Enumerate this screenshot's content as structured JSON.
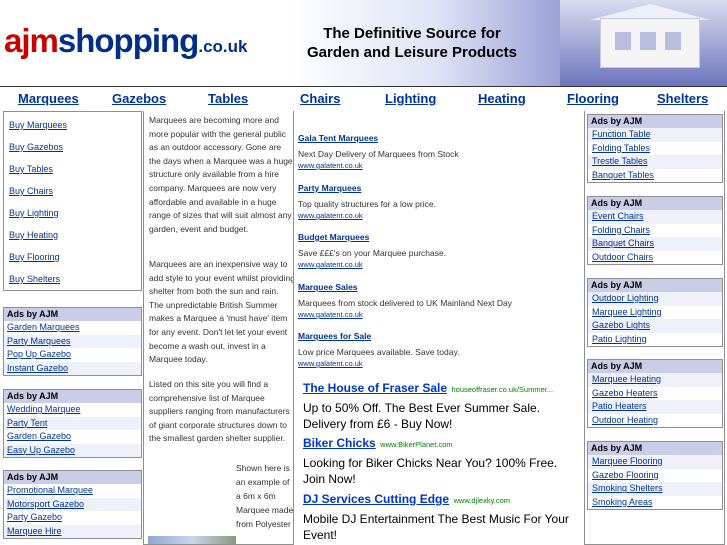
{
  "header": {
    "logo_ajm": "ajm",
    "logo_shopping": "shopping",
    "logo_couk": ".co.uk",
    "tagline_line1": "The Definitive Source for",
    "tagline_line2": "Garden and Leisure Products"
  },
  "nav": [
    "Marquees",
    "Gazebos",
    "Tables",
    "Chairs",
    "Lighting",
    "Heating",
    "Flooring",
    "Shelters"
  ],
  "left_links": [
    "Buy Marquees",
    "Buy Gazebos",
    "Buy Tables",
    "Buy Chairs",
    "Buy Lighting",
    "Buy Heating",
    "Buy Flooring",
    "Buy Shelters"
  ],
  "left_ads": [
    {
      "title": "Ads by AJM",
      "links": [
        "Garden Marquees",
        "Party Marquees",
        "Pop Up Gazebo",
        "Instant Gazebo"
      ]
    },
    {
      "title": "Ads by AJM",
      "links": [
        "Wedding Marquee",
        "Party Tent",
        "Garden Gazebo",
        "Easy Up Gazebo"
      ]
    },
    {
      "title": "Ads by AJM",
      "links": [
        "Promotional Marquee",
        "Motorsport Gazebo",
        "Party Gazebo",
        "Marquee Hire"
      ]
    }
  ],
  "intro": {
    "p1": "Marquees are becoming more and more popular with the general public as an outdoor accessory. Gone are the days when a Marquee was a huge structure only available from a hire company. Marquees are now very affordable and available in a huge range of sizes that will suit almost any garden, event and budget.",
    "p2": "Marquees are an inexpensive way to add style to your event whilst providing shelter from both the sun and rain. The unpredictable British Summer makes a Marquee a 'must have' item for any event. Don't let let your event become a wash out, invest in a Marquee today.",
    "p3": "Listed on this site you will find a comprehensive list of Marquee suppliers ranging from manufacturers of giant corporate structures down to the smallest garden shelter supplier.",
    "caption": "Shown here is an example of a 6m x 6m Marquee made from Polyester"
  },
  "small_ads": [
    {
      "title": "Gala Tent Marquees",
      "desc": "Next Day Delivery of Marquees from Stock",
      "url": "www.galatent.co.uk"
    },
    {
      "title": "Party Marquees",
      "desc": "Top quality structures for a low price.",
      "url": "www.galatent.co.uk"
    },
    {
      "title": "Budget Marquees",
      "desc": "Save £££'s on your Marquee purchase.",
      "url": "www.galatent.co.uk"
    },
    {
      "title": "Marquee Sales",
      "desc": "Marquees from stock delivered to UK Mainland Next Day",
      "url": "www.galatent.co.uk"
    },
    {
      "title": "Marquees for Sale",
      "desc": "Low price Marquees available. Save today.",
      "url": "www.galatent.co.uk"
    }
  ],
  "big_ads": [
    {
      "title": "The House of Fraser Sale",
      "site": "houseoffraser.co.uk/Summer...",
      "desc": "Up to 50% Off. The Best Ever Summer Sale. Delivery from £6 - Buy Now!"
    },
    {
      "title": "Biker Chicks",
      "site": "www.BikerPlanet.com",
      "desc": "Looking for Biker Chicks Near You? 100% Free. Join Now!"
    },
    {
      "title": "DJ Services Cutting Edge",
      "site": "www.djlexky.com",
      "desc": "Mobile DJ Entertainment The Best Music For Your Event!"
    }
  ],
  "right_ads": [
    {
      "title": "Ads by AJM",
      "links": [
        "Function Table",
        "Folding Tables",
        "Trestle Tables",
        "Banquet Tables"
      ]
    },
    {
      "title": "Ads by AJM",
      "links": [
        "Event Chairs",
        "Folding Chairs",
        "Banquet Chairs",
        "Outdoor Chairs"
      ]
    },
    {
      "title": "Ads by AJM",
      "links": [
        "Outdoor Lighting",
        "Marquee Lighting",
        "Gazebo Lights",
        "Patio Lighting"
      ]
    },
    {
      "title": "Ads by AJM",
      "links": [
        "Marquee Heating",
        "Gazebo Heaters",
        "Patio Heaters",
        "Outdoor Heating"
      ]
    },
    {
      "title": "Ads by AJM",
      "links": [
        "Marquee Flooring",
        "Gazebo Flooring",
        "Smoking Shelters",
        "Smoking Areas"
      ]
    }
  ]
}
